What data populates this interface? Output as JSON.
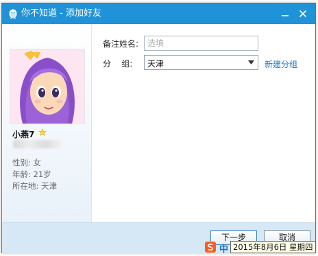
{
  "window": {
    "title": "你不知道 - 添加好友"
  },
  "profile": {
    "nickname": "小燕7",
    "gender": "性别: 女",
    "age": "年龄: 21岁",
    "location": "所在地:  天津"
  },
  "form": {
    "remark_label": "备注姓名:",
    "remark_placeholder": "选填",
    "remark_value": "",
    "group_label": "分    组:",
    "group_value": "天津",
    "new_group_link": "新建分组"
  },
  "footer": {
    "next_label": "下一步",
    "cancel_label": "取消"
  },
  "ime": {
    "mode": "中",
    "date_tip": "2015年8月6日 星期四"
  },
  "colors": {
    "titlebar": "#1f92d8",
    "link": "#1a7ac7",
    "footer": "#d6e7f5"
  },
  "icons": {
    "app": "penguin-icon",
    "minimize": "minimize-icon",
    "close": "close-icon",
    "star": "star-icon",
    "dropdown": "chevron-down-icon",
    "ime": "sogou-icon"
  }
}
